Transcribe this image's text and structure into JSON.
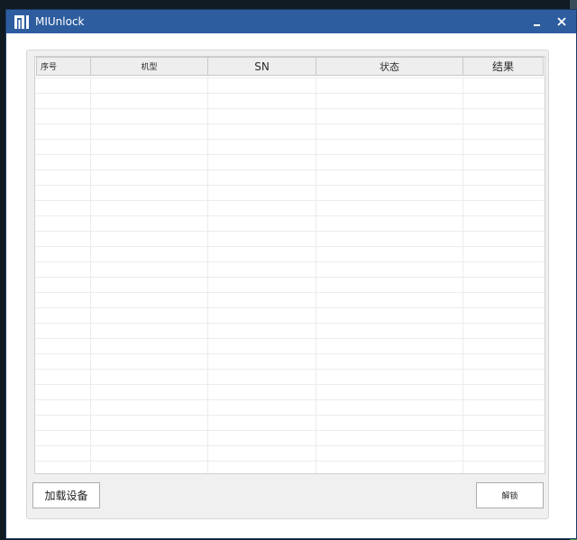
{
  "window": {
    "title": "MIUnlock"
  },
  "titlebar": {
    "minimize_glyph": "_",
    "close_glyph": "✕"
  },
  "table": {
    "columns": [
      {
        "label": "序号"
      },
      {
        "label": "机型"
      },
      {
        "label": "SN"
      },
      {
        "label": "状态"
      },
      {
        "label": "结果"
      }
    ],
    "rows": []
  },
  "buttons": {
    "load_devices": "加载设备",
    "unlock": "解锁"
  },
  "icons": {
    "logo": "mi-logo-icon",
    "minimize": "minimize-icon",
    "close": "close-icon"
  },
  "colors": {
    "titlebar": "#2e5d9f",
    "window_bg": "#ffffff",
    "panel_bg": "#f0f0f0",
    "header_bg": "#eeeeee"
  }
}
